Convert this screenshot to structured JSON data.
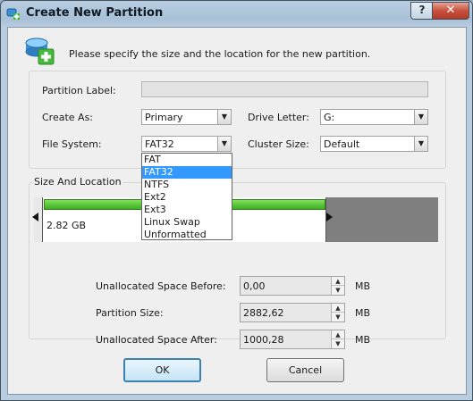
{
  "window": {
    "title": "Create New Partition"
  },
  "titlebar": {
    "help_label": "?",
    "close_label": "✕"
  },
  "header": {
    "instruction": "Please specify the size and the location for the new partition."
  },
  "form": {
    "partition_label": {
      "label": "Partition Label:",
      "value": ""
    },
    "create_as": {
      "label": "Create As:",
      "value": "Primary"
    },
    "drive_letter": {
      "label": "Drive Letter:",
      "value": "G:"
    },
    "file_system": {
      "label": "File System:",
      "value": "FAT32"
    },
    "cluster_size": {
      "label": "Cluster Size:",
      "value": "Default"
    }
  },
  "file_system_dropdown": {
    "options": [
      "FAT",
      "FAT32",
      "NTFS",
      "Ext2",
      "Ext3",
      "Linux Swap",
      "Unformatted"
    ],
    "selected": "FAT32"
  },
  "size_location": {
    "title": "Size And Location",
    "bar_size_label": "2.82 GB",
    "unallocated_before": {
      "label": "Unallocated Space Before:",
      "value": "0,00",
      "unit": "MB"
    },
    "partition_size": {
      "label": "Partition Size:",
      "value": "2882,62",
      "unit": "MB"
    },
    "unallocated_after": {
      "label": "Unallocated Space After:",
      "value": "1000,28",
      "unit": "MB"
    }
  },
  "buttons": {
    "ok": "OK",
    "cancel": "Cancel"
  },
  "colors": {
    "partition_bar": "#3fae23",
    "selection": "#3399ff",
    "unallocated": "#7f7f7f"
  },
  "icons": {
    "title": "add-partition-icon",
    "header": "add-partition-icon"
  }
}
